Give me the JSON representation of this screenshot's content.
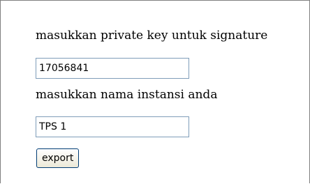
{
  "form": {
    "private_key_label": "masukkan private key untuk signature",
    "private_key_value": "17056841",
    "instance_label": "masukkan nama instansi anda",
    "instance_value": "TPS 1",
    "export_label": "export"
  }
}
